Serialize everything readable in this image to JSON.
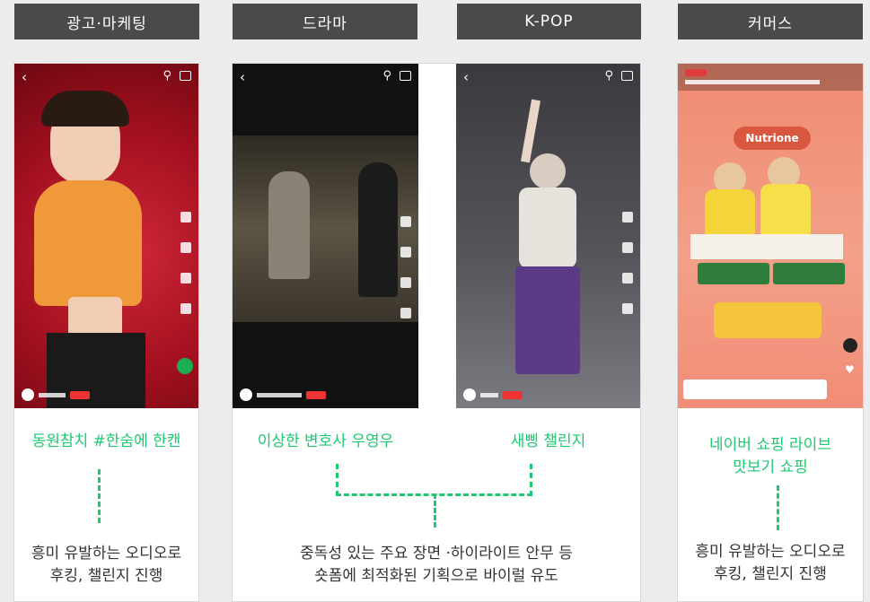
{
  "headers": [
    "광고·마케팅",
    "드라마",
    "K-POP",
    "커머스"
  ],
  "ad": {
    "title": "동원참치 #한숨에 한캔",
    "desc1": "흥미 유발하는 오디오로",
    "desc2": "후킹, 챌린지 진행"
  },
  "drama": {
    "title": "이상한 변호사 우영우"
  },
  "kpop": {
    "title": "새삥 챌린지"
  },
  "shared": {
    "desc1": "중독성 있는 주요 장면 ·하이라이트 안무 등",
    "desc2": "숏폼에 최적화된 기획으로 바이럴 유도"
  },
  "commerce": {
    "title1": "네이버 쇼핑 라이브",
    "title2": "맛보기 쇼핑",
    "desc1": "흥미 유발하는 오디오로",
    "desc2": "후킹, 챌린지 진행",
    "brand": "Nutrione"
  },
  "colors": {
    "accent": "#1ec971",
    "header_bg": "#4a4a4a"
  }
}
